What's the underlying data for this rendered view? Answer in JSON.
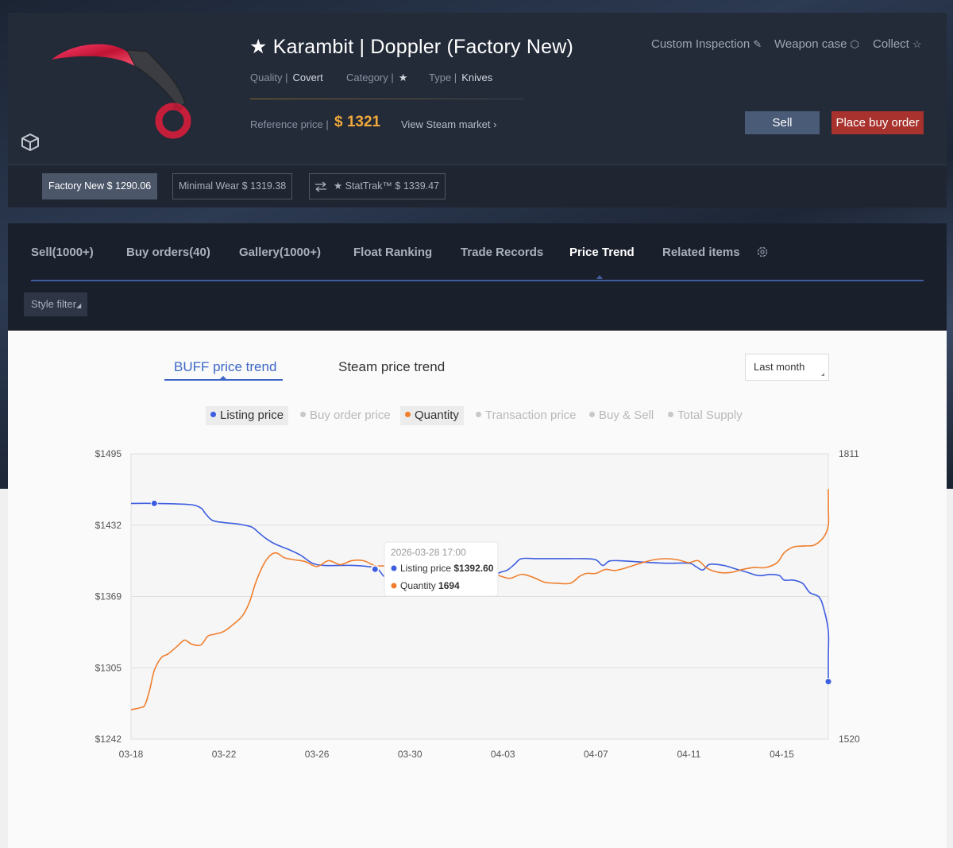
{
  "item": {
    "title": "★ Karambit | Doppler (Factory New)",
    "quality_label": "Quality |",
    "quality_value": "Covert",
    "category_label": "Category |",
    "category_value": "★",
    "type_label": "Type |",
    "type_value": "Knives",
    "reference_label": "Reference price |",
    "reference_price": "$ 1321",
    "steam_link": "View Steam market ›"
  },
  "top_links": {
    "custom_inspection": "Custom Inspection",
    "weapon_case": "Weapon case",
    "collect": "Collect"
  },
  "actions": {
    "sell": "Sell",
    "buy_order": "Place buy order"
  },
  "variants": [
    {
      "label": "Factory New $ 1290.06",
      "active": true
    },
    {
      "label": "Minimal Wear $ 1319.38",
      "active": false
    },
    {
      "label": "★ StatTrak™ $ 1339.47",
      "active": false
    }
  ],
  "tabs": [
    {
      "label": "Sell(1000+)"
    },
    {
      "label": "Buy orders(40)"
    },
    {
      "label": "Gallery(1000+)"
    },
    {
      "label": "Float Ranking"
    },
    {
      "label": "Trade Records"
    },
    {
      "label": "Price Trend",
      "active": true
    },
    {
      "label": "Related items"
    }
  ],
  "style_filter": "Style filter",
  "trend": {
    "buff_tab": "BUFF price trend",
    "steam_tab": "Steam price trend",
    "range": "Last month"
  },
  "legend": [
    {
      "label": "Listing price",
      "on": true,
      "color": "#3d5ee0"
    },
    {
      "label": "Buy order price",
      "on": false,
      "color": "#c8c8c8"
    },
    {
      "label": "Quantity",
      "on": true,
      "color": "#ef7f2f"
    },
    {
      "label": "Transaction price",
      "on": false,
      "color": "#c8c8c8"
    },
    {
      "label": "Buy & Sell",
      "on": false,
      "color": "#c8c8c8"
    },
    {
      "label": "Total Supply",
      "on": false,
      "color": "#c8c8c8"
    }
  ],
  "tooltip": {
    "date": "2026-03-28 17:00",
    "listing_label": "Listing price",
    "listing_value": "$1392.60",
    "quantity_label": "Quantity",
    "quantity_value": "1694"
  },
  "colors": {
    "listing": "#3d5ee0",
    "quantity": "#ef7f2f",
    "accent": "#3d67c6",
    "price": "#f0a93a",
    "buy_button": "#a8322d"
  },
  "chart_data": {
    "type": "line",
    "x_ticks": [
      "03-18",
      "03-22",
      "03-26",
      "03-30",
      "04-03",
      "04-07",
      "04-11",
      "04-15"
    ],
    "y_left_ticks": [
      "$1495",
      "$1432",
      "$1369",
      "$1305",
      "$1242"
    ],
    "y_right_ticks": [
      "1811",
      "1520"
    ],
    "ylim_left": [
      1242,
      1495
    ],
    "ylim_right": [
      1520,
      1811
    ],
    "x_range_days": [
      0,
      30
    ],
    "series": [
      {
        "name": "Listing price",
        "axis": "left",
        "color": "#3d5ee0",
        "points": [
          [
            0,
            1451
          ],
          [
            1.0,
            1451
          ],
          [
            2.5,
            1450
          ],
          [
            3.0,
            1447
          ],
          [
            3.2,
            1442
          ],
          [
            3.5,
            1436
          ],
          [
            4.0,
            1434
          ],
          [
            4.5,
            1433
          ],
          [
            4.8,
            1432
          ],
          [
            5.2,
            1430
          ],
          [
            5.5,
            1425
          ],
          [
            5.8,
            1420
          ],
          [
            6.2,
            1415
          ],
          [
            6.8,
            1410
          ],
          [
            7.3,
            1405
          ],
          [
            7.8,
            1398
          ],
          [
            8.3,
            1396
          ],
          [
            9.0,
            1396
          ],
          [
            9.5,
            1396
          ],
          [
            10.2,
            1395
          ],
          [
            10.6,
            1393
          ],
          [
            10.9,
            1386
          ],
          [
            11.3,
            1382
          ],
          [
            11.8,
            1382
          ],
          [
            12.3,
            1389
          ],
          [
            12.8,
            1395
          ],
          [
            13.3,
            1395
          ],
          [
            14.0,
            1393
          ],
          [
            14.8,
            1390
          ],
          [
            15.5,
            1387
          ],
          [
            15.9,
            1390
          ],
          [
            16.2,
            1392
          ],
          [
            16.5,
            1397
          ],
          [
            16.8,
            1402
          ],
          [
            17.5,
            1402
          ],
          [
            18.5,
            1402
          ],
          [
            19.5,
            1402
          ],
          [
            20.0,
            1401
          ],
          [
            20.3,
            1396
          ],
          [
            20.6,
            1400
          ],
          [
            21.2,
            1400
          ],
          [
            22.0,
            1399
          ],
          [
            23.0,
            1398
          ],
          [
            24.0,
            1398
          ],
          [
            24.3,
            1395
          ],
          [
            24.6,
            1392
          ],
          [
            24.9,
            1397
          ],
          [
            25.5,
            1396
          ],
          [
            26.0,
            1393
          ],
          [
            26.5,
            1390
          ],
          [
            27.0,
            1387
          ],
          [
            27.5,
            1388
          ],
          [
            27.9,
            1387
          ],
          [
            28.1,
            1383
          ],
          [
            28.5,
            1383
          ],
          [
            28.9,
            1380
          ],
          [
            29.2,
            1372
          ],
          [
            29.6,
            1368
          ],
          [
            29.8,
            1358
          ],
          [
            30.0,
            1338
          ],
          [
            30.2,
            1316
          ],
          [
            30.4,
            1302
          ],
          [
            30.6,
            1293
          ]
        ]
      },
      {
        "name": "Quantity",
        "axis": "right",
        "color": "#ef7f2f",
        "points": [
          [
            0,
            1550
          ],
          [
            0.4,
            1552
          ],
          [
            0.6,
            1555
          ],
          [
            0.8,
            1570
          ],
          [
            1.0,
            1590
          ],
          [
            1.3,
            1603
          ],
          [
            1.6,
            1607
          ],
          [
            2.0,
            1615
          ],
          [
            2.3,
            1621
          ],
          [
            2.6,
            1617
          ],
          [
            3.0,
            1616
          ],
          [
            3.3,
            1625
          ],
          [
            3.6,
            1627
          ],
          [
            4.0,
            1630
          ],
          [
            4.4,
            1637
          ],
          [
            4.8,
            1646
          ],
          [
            5.1,
            1660
          ],
          [
            5.4,
            1682
          ],
          [
            5.8,
            1702
          ],
          [
            6.2,
            1710
          ],
          [
            6.6,
            1705
          ],
          [
            7.0,
            1703
          ],
          [
            7.5,
            1701
          ],
          [
            8.0,
            1696
          ],
          [
            8.5,
            1702
          ],
          [
            9.0,
            1698
          ],
          [
            9.5,
            1702
          ],
          [
            10.0,
            1702
          ],
          [
            10.5,
            1697
          ],
          [
            11.0,
            1697
          ],
          [
            11.5,
            1699
          ],
          [
            12.0,
            1697
          ],
          [
            12.5,
            1696
          ],
          [
            13.0,
            1695
          ],
          [
            13.6,
            1693
          ],
          [
            14.2,
            1694
          ],
          [
            14.8,
            1692
          ],
          [
            15.4,
            1690
          ],
          [
            15.8,
            1687
          ],
          [
            16.3,
            1684
          ],
          [
            16.8,
            1688
          ],
          [
            17.3,
            1685
          ],
          [
            17.8,
            1680
          ],
          [
            18.3,
            1679
          ],
          [
            18.9,
            1679
          ],
          [
            19.3,
            1686
          ],
          [
            19.6,
            1689
          ],
          [
            20.0,
            1689
          ],
          [
            20.4,
            1693
          ],
          [
            20.8,
            1692
          ],
          [
            21.2,
            1694
          ],
          [
            21.6,
            1697
          ],
          [
            22.0,
            1700
          ],
          [
            22.5,
            1703
          ],
          [
            23.0,
            1704
          ],
          [
            23.5,
            1703
          ],
          [
            24.0,
            1700
          ],
          [
            24.4,
            1702
          ],
          [
            24.8,
            1694
          ],
          [
            25.3,
            1690
          ],
          [
            25.8,
            1690
          ],
          [
            26.3,
            1693
          ],
          [
            26.8,
            1695
          ],
          [
            27.3,
            1695
          ],
          [
            27.8,
            1700
          ],
          [
            28.1,
            1710
          ],
          [
            28.5,
            1716
          ],
          [
            29.0,
            1717
          ],
          [
            29.4,
            1718
          ],
          [
            29.8,
            1726
          ],
          [
            30.2,
            1738
          ],
          [
            30.6,
            1756
          ],
          [
            31.0,
            1775
          ]
        ]
      }
    ],
    "highlight_point": {
      "x_day": 10.5,
      "listing_price": 1392.6,
      "quantity": 1694
    },
    "marker_points": [
      {
        "series": "Listing price",
        "x_day": 1.0
      },
      {
        "series": "Listing price",
        "x_day": 30.6
      }
    ]
  }
}
